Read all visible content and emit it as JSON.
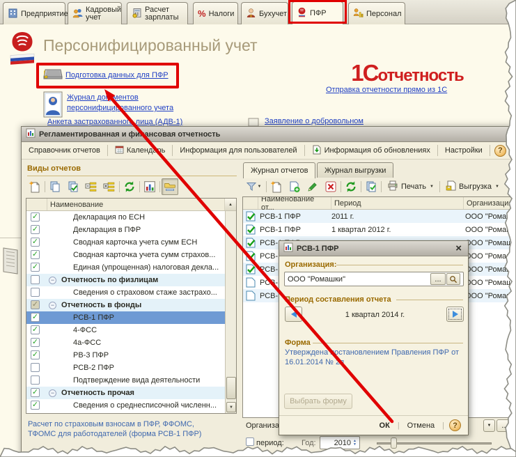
{
  "colors": {
    "accent_red": "#e00000",
    "link_blue": "#1f3fc4",
    "info_blue": "#3f68ae",
    "header_brown": "#9a6a00",
    "selection_blue": "#6e9ad4"
  },
  "icons": {
    "check": "✓",
    "collapse": "−",
    "caret_down": "▼",
    "scroll_up": "▲",
    "scroll_down": "▼",
    "close": "×",
    "help": "?",
    "ellipsis": "...",
    "spin_up": "▲",
    "spin_down": "▼"
  },
  "tabs": [
    {
      "label": "Предприятие"
    },
    {
      "label": "Кадровый учет"
    },
    {
      "label": "Расчет зарплаты"
    },
    {
      "label": "Налоги"
    },
    {
      "label": "Бухучет"
    },
    {
      "label": "ПФР"
    },
    {
      "label": "Персонал"
    }
  ],
  "page": {
    "title": "Персонифицированный учет",
    "prepare_link": "Подготовка данных для ПФР",
    "journal_link_line1": "Журнал документов",
    "journal_link_line2": "персонифицированного учета",
    "anketa_link": "Анкета застрахованного лица (АДВ-1)",
    "zayavlenie_link": "Заявление о добровольном",
    "brand_1c": "1С",
    "brand_otchetnost": "отчетность",
    "brand_link": "Отправка отчетности прямо из 1С"
  },
  "window": {
    "title": "Регламентированная и финансовая отчетность",
    "menu": [
      "Справочник отчетов",
      "Календарь",
      "Информация для пользователей",
      "Информация об обновлениях",
      "Настройки"
    ]
  },
  "report_types": {
    "header": "Виды отчетов",
    "column": "Наименование",
    "rows": [
      {
        "checked": true,
        "label": "Декларация по ЕСН"
      },
      {
        "checked": true,
        "label": "Декларация в ПФР"
      },
      {
        "checked": true,
        "label": "Сводная карточка учета сумм ЕСН"
      },
      {
        "checked": true,
        "label": "Сводная карточка учета сумм страхов..."
      },
      {
        "checked": true,
        "label": "Единая (упрощенная) налоговая декла..."
      },
      {
        "checked": false,
        "group": true,
        "label": "Отчетность по физлицам"
      },
      {
        "checked": false,
        "label": "Сведения о страховом стаже застрахо..."
      },
      {
        "checked": "partial",
        "group": true,
        "label": "Отчетность в фонды"
      },
      {
        "checked": true,
        "label": "РСВ-1 ПФР",
        "selected": true
      },
      {
        "checked": true,
        "label": "4-ФСС"
      },
      {
        "checked": true,
        "label": "4а-ФСС"
      },
      {
        "checked": true,
        "label": "РВ-3 ПФР"
      },
      {
        "checked": false,
        "label": "РСВ-2 ПФР"
      },
      {
        "checked": false,
        "label": "Подтверждение вида деятельности"
      },
      {
        "checked": true,
        "group": true,
        "label": "Отчетность прочая"
      },
      {
        "checked": true,
        "label": "Сведения о среднесписочной численн..."
      }
    ],
    "footnote": [
      "Расчет по страховым взносам в ПФР, ФФОМС,",
      "ТФОМС для работодателей (форма РСВ-1 ПФР)"
    ]
  },
  "journal": {
    "tabs": [
      "Журнал отчетов",
      "Журнал выгрузки"
    ],
    "print_label": "Печать",
    "export_label": "Выгрузка",
    "columns": [
      "Наименование от...",
      "Период",
      "Организация"
    ],
    "rows": [
      {
        "status": "approved",
        "name": "РСВ-1 ПФР",
        "period": "2011 г.",
        "org": "ООО \"Ромаш..."
      },
      {
        "status": "approved",
        "name": "РСВ-1 ПФР",
        "period": "1 квартал 2012 г.",
        "org": "ООО \"Ромаш..."
      },
      {
        "status": "approved",
        "name": "РСВ-1 ПФР",
        "period": "",
        "org": "ООО \"Ромаш..."
      },
      {
        "status": "approved",
        "name": "РСВ-1 ПФР",
        "period": "",
        "org": "ООО \"Ромаш..."
      },
      {
        "status": "approved",
        "name": "РСВ-1 ПФР",
        "period": "",
        "org": "ООО \"Ромаш..."
      },
      {
        "status": "plain",
        "name": "РСВ-1 ПФР",
        "period": "",
        "org": "ООО \"Ромаш..."
      },
      {
        "status": "plain",
        "name": "РСВ-1 ПФР",
        "period": "",
        "org": "ООО \"Ромаш..."
      }
    ],
    "org_label": "Организация",
    "period_label": "период:",
    "year_label": "Год:",
    "year_value": "2010"
  },
  "modal": {
    "title": "РСВ-1 ПФР",
    "org_label": "Организация:",
    "org_value": "ООО \"Ромашки\"",
    "period_label": "Период составления отчета",
    "period_value": "1 квартал 2014 г.",
    "form_label": "Форма",
    "form_text": "Утверждена постановлением Правления ПФР от 16.01.2014 № 2п",
    "select_form_label": "Выбрать форму",
    "ok_label": "ОК",
    "cancel_label": "Отмена"
  }
}
